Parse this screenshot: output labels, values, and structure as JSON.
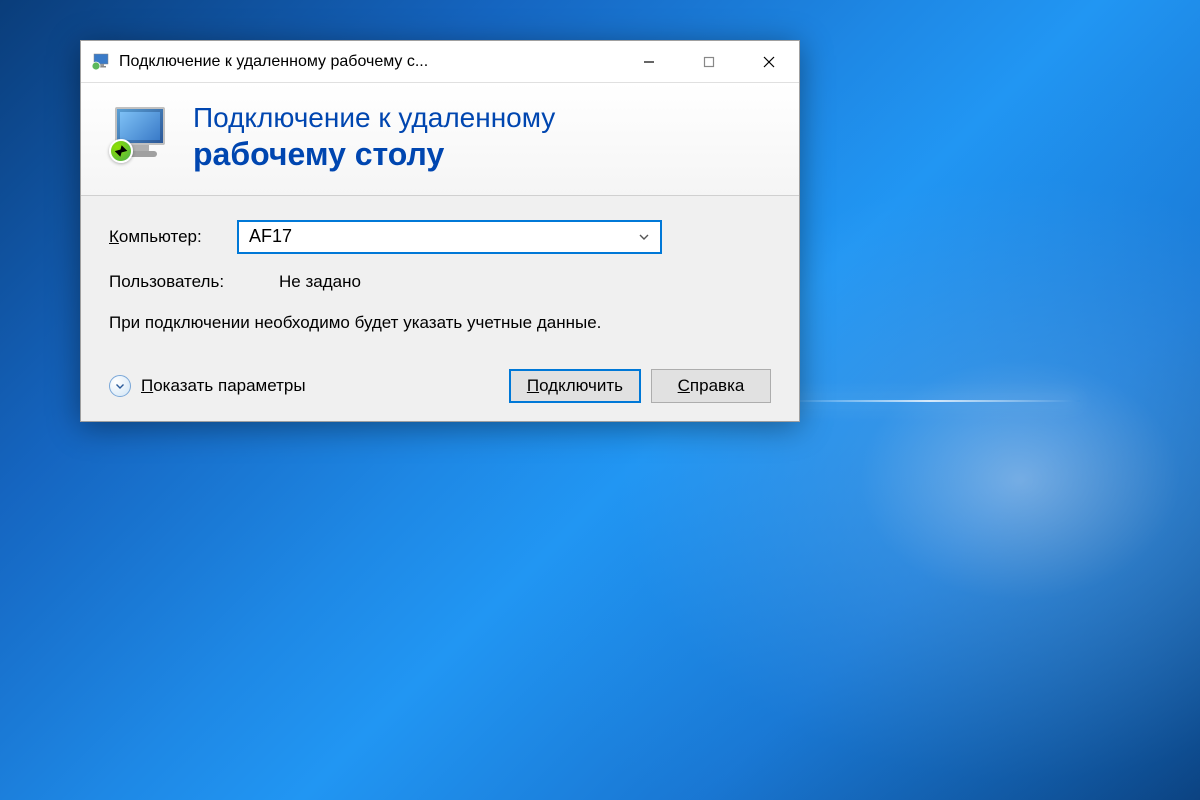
{
  "window": {
    "title": "Подключение к удаленному рабочему с..."
  },
  "header": {
    "line1": "Подключение к удаленному",
    "line2": "рабочему столу"
  },
  "form": {
    "computer_label": "Компьютер:",
    "computer_value": "AF17",
    "user_label": "Пользователь:",
    "user_value": "Не задано",
    "info_text": "При подключении необходимо будет указать учетные данные."
  },
  "footer": {
    "show_options": "Показать параметры",
    "connect": "Подключить",
    "help": "Справка"
  }
}
